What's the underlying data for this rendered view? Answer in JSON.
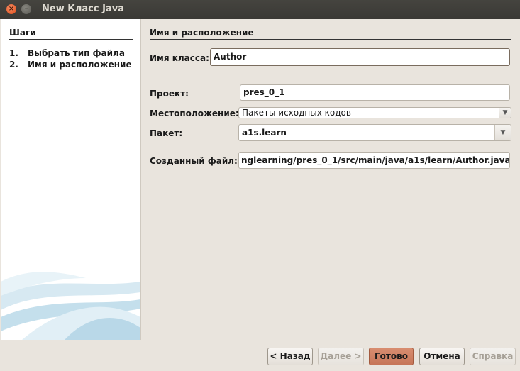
{
  "window": {
    "title": "New Класс Java"
  },
  "steps": {
    "title": "Шаги",
    "items": [
      {
        "num": "1.",
        "label": "Выбрать тип файла"
      },
      {
        "num": "2.",
        "label": "Имя и расположение"
      }
    ]
  },
  "form": {
    "section_title": "Имя и расположение",
    "class_name_label": "Имя класса:",
    "class_name_value": "Author",
    "project_label": "Проект:",
    "project_value": "pres_0_1",
    "location_label": "Местоположение:",
    "location_value": "Пакеты исходных кодов",
    "package_label": "Пакет:",
    "package_value": "a1s.learn",
    "created_file_label": "Созданный файл:",
    "created_file_value": "nglearning/pres_0_1/src/main/java/a1s/learn/Author.java"
  },
  "buttons": {
    "back": "< Назад",
    "next": "Далее >",
    "finish": "Готово",
    "cancel": "Отмена",
    "help": "Справка"
  },
  "colors": {
    "accent": "#c67558",
    "title_bar": "#3c3b37",
    "close": "#df4a16"
  },
  "icons": {
    "close": "close-icon",
    "minimize": "minimize-icon",
    "combo": "chevron-down-icon"
  }
}
